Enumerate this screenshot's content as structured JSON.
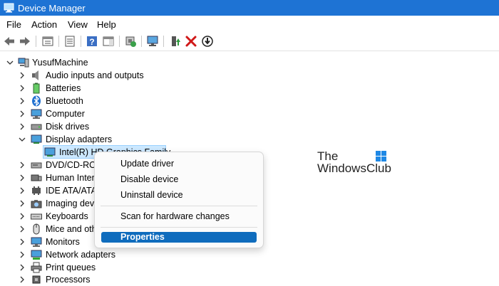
{
  "window": {
    "title": "Device Manager",
    "title_bar_color": "#1e73d4"
  },
  "menu": [
    "File",
    "Action",
    "View",
    "Help"
  ],
  "toolbar": [
    "back-arrow-icon",
    "forward-arrow-icon",
    "properties-icon",
    "show-hidden-icon",
    "help-icon",
    "action-pane-icon",
    "scan-hardware-icon",
    "monitor-icon",
    "update-driver-icon",
    "uninstall-icon",
    "download-icon"
  ],
  "tree": {
    "root": "YusufMachine",
    "categories": [
      {
        "label": "Audio inputs and outputs",
        "icon": "speaker-icon",
        "expanded": false
      },
      {
        "label": "Batteries",
        "icon": "battery-icon",
        "expanded": false
      },
      {
        "label": "Bluetooth",
        "icon": "bluetooth-icon",
        "expanded": false
      },
      {
        "label": "Computer",
        "icon": "computer-icon",
        "expanded": false
      },
      {
        "label": "Disk drives",
        "icon": "disk-icon",
        "expanded": false
      },
      {
        "label": "Display adapters",
        "icon": "display-adapter-icon",
        "expanded": true
      },
      {
        "label": "DVD/CD-ROI",
        "icon": "dvd-icon",
        "expanded": false
      },
      {
        "label": "Human Inter",
        "icon": "hid-icon",
        "expanded": false
      },
      {
        "label": "IDE ATA/ATAI",
        "icon": "ide-icon",
        "expanded": false
      },
      {
        "label": "Imaging dev",
        "icon": "camera-icon",
        "expanded": false
      },
      {
        "label": "Keyboards",
        "icon": "keyboard-icon",
        "expanded": false
      },
      {
        "label": "Mice and oth",
        "icon": "mouse-icon",
        "expanded": false
      },
      {
        "label": "Monitors",
        "icon": "monitor-icon",
        "expanded": false
      },
      {
        "label": "Network adapters",
        "icon": "network-icon",
        "expanded": false
      },
      {
        "label": "Print queues",
        "icon": "printer-icon",
        "expanded": false
      },
      {
        "label": "Processors",
        "icon": "processor-icon",
        "expanded": false
      }
    ],
    "selected_device": "Intel(R) HD Graphics Family"
  },
  "context_menu": {
    "items": [
      "Update driver",
      "Disable device",
      "Uninstall device",
      "Scan for hardware changes",
      "Properties"
    ],
    "highlighted": "Properties",
    "highlight_color": "#0f6cbd"
  },
  "watermark": {
    "line1": "The",
    "line2": "WindowsClub"
  }
}
